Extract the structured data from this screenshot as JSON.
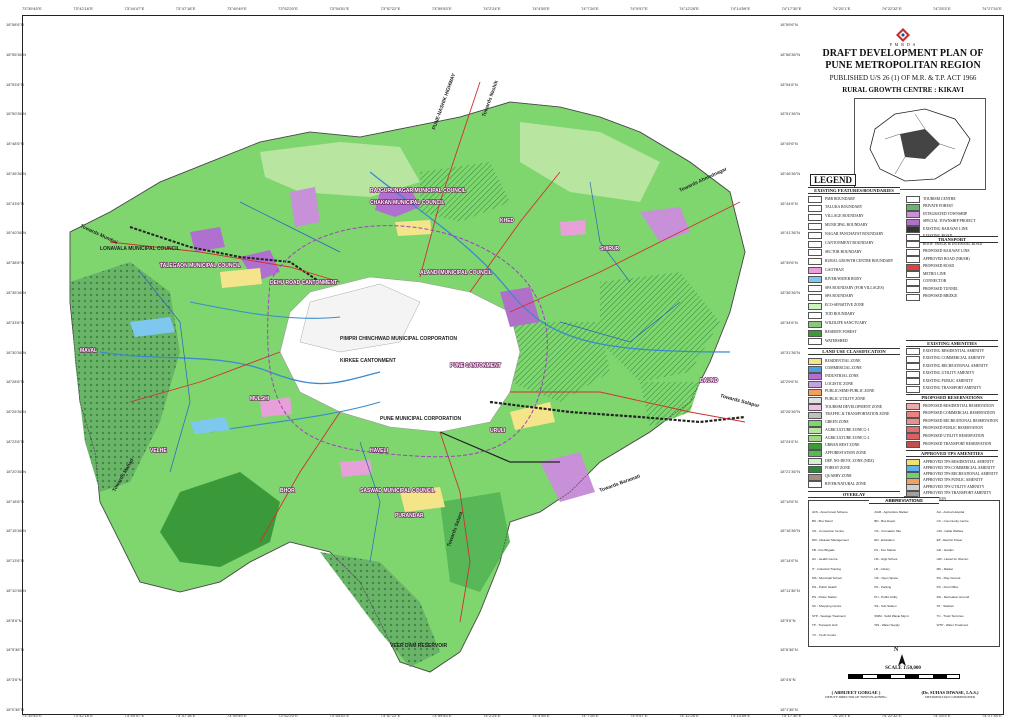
{
  "ticks_top": [
    "73°39'45\"E",
    "73°42'16\"E",
    "73°44'47\"E",
    "73°47'18\"E",
    "73°49'49\"E",
    "73°52'20\"E",
    "73°54'51\"E",
    "73°57'22\"E",
    "73°59'53\"E",
    "74°2'24\"E",
    "74°4'55\"E",
    "74°7'26\"E",
    "74°9'57\"E",
    "74°12'28\"E",
    "74°14'59\"E",
    "74°17'30\"E",
    "74°20'1\"E",
    "74°22'32\"E",
    "74°25'3\"E",
    "74°27'34\"E"
  ],
  "ticks_bottom": [
    "73°39'45\"E",
    "73°42'16\"E",
    "73°44'47\"E",
    "73°47'18\"E",
    "73°49'49\"E",
    "73°52'20\"E",
    "73°54'51\"E",
    "73°57'22\"E",
    "73°59'53\"E",
    "74°2'24\"E",
    "74°4'55\"E",
    "74°7'26\"E",
    "74°9'57\"E",
    "74°12'28\"E",
    "74°14'59\"E",
    "74°17'30\"E",
    "74°20'1\"E",
    "74°22'32\"E",
    "74°25'3\"E",
    "74°27'34\"E"
  ],
  "ticks_left": [
    "18°58'6\"N",
    "18°55'36\"N",
    "18°53'6\"N",
    "18°50'36\"N",
    "18°48'6\"N",
    "18°45'36\"N",
    "18°43'6\"N",
    "18°40'36\"N",
    "18°38'6\"N",
    "18°35'36\"N",
    "18°33'6\"N",
    "18°30'36\"N",
    "18°28'6\"N",
    "18°25'36\"N",
    "18°23'6\"N",
    "18°20'36\"N",
    "18°18'6\"N",
    "18°15'36\"N",
    "18°13'6\"N",
    "18°10'36\"N",
    "18°8'6\"N",
    "18°5'36\"N",
    "18°3'6\"N",
    "18°0'36\"N"
  ],
  "ticks_right": [
    "18°59'6\"N",
    "18°56'36\"N",
    "18°54'6\"N",
    "18°51'36\"N",
    "18°49'6\"N",
    "18°46'36\"N",
    "18°44'6\"N",
    "18°41'36\"N",
    "18°39'6\"N",
    "18°36'36\"N",
    "18°34'6\"N",
    "18°31'36\"N",
    "18°29'6\"N",
    "18°26'36\"N",
    "18°24'6\"N",
    "18°21'36\"N",
    "18°19'6\"N",
    "18°16'36\"N",
    "18°14'6\"N",
    "18°11'36\"N",
    "18°9'6\"N",
    "18°6'36\"N",
    "18°4'6\"N",
    "18°1'36\"N"
  ],
  "header": {
    "brand_small": "P M R D A",
    "title1": "DRAFT DEVELOPMENT PLAN OF",
    "title2": "PUNE METROPOLITAN REGION",
    "published": "PUBLISHED U/S 26 (1) OF M.R. & T.P. ACT 1966",
    "rgc": "RURAL GROWTH CENTRE : KIKAVI",
    "legend": "LEGEND"
  },
  "sections": {
    "existing": "EXISTING FEATURES/BOUNDARIES",
    "transport": "TRANSPORT",
    "landuse": "LAND USE CLASSIFICATION",
    "amenities": "EXISTING AMENITIES",
    "proposed": "PROPOSED RESERVATIONS",
    "approved": "APPROVED TPS AMENITIES",
    "overlay": "OVERLAY",
    "abbr": "ABBREVIATIONS"
  },
  "legend_left": [
    {
      "label": "PMR BOUNDARY",
      "color": "#ffffff"
    },
    {
      "label": "TALUKA BOUNDARY",
      "color": "#ffffff"
    },
    {
      "label": "VILLAGE BOUNDARY",
      "color": "#ffffff"
    },
    {
      "label": "MUNICIPAL BOUNDARY",
      "color": "#ffffff"
    },
    {
      "label": "NAGAR PANCHAYAT BOUNDARY",
      "color": "#ffffff"
    },
    {
      "label": "CANTONMENT BOUNDARY",
      "color": "#ffffff"
    },
    {
      "label": "SECTOR BOUNDARY",
      "color": "#ffffff"
    },
    {
      "label": "RURAL GROWTH CENTRE BOUNDARY",
      "color": "#ffffff"
    },
    {
      "label": "GAOTHAN",
      "color": "#e8a0d8"
    },
    {
      "label": "RIVER/WATER BODY",
      "color": "#7ec8f0"
    },
    {
      "label": "SPA BOUNDARY (FOR VILLAGES)",
      "color": "#ffffff"
    },
    {
      "label": "SPA BOUNDARY",
      "color": "#ffffff"
    },
    {
      "label": "ECO-SENSITIVE ZONE",
      "color": "#d0f0c0"
    },
    {
      "label": "TOD BOUNDARY",
      "color": "#ffffff"
    },
    {
      "label": "WILDLIFE SANCTUARY",
      "color": "#88c878"
    },
    {
      "label": "RESERVE FOREST",
      "color": "#3a9a3a"
    },
    {
      "label": "WATERSHED",
      "color": "#ffffff"
    }
  ],
  "legend_right": [
    {
      "label": "TOURISM CENTRE",
      "color": "#ffffff"
    },
    {
      "label": "PRIVATE FOREST",
      "color": "#6ab46a"
    },
    {
      "label": "INTEGRATED TOWNSHIP",
      "color": "#c890d8"
    },
    {
      "label": "SPECIAL TOWNSHIP PROJECT",
      "color": "#b070c8"
    },
    {
      "label": "EXISTING RAILWAY LINE",
      "color": "#333333"
    },
    {
      "label": "EXISTING ROAD",
      "color": "#ffffff"
    },
    {
      "label": "ROOF TRACK & INTERNAL ROAD",
      "color": "#ffffff"
    },
    {
      "label": "PROPOSED RAILWAY LINE",
      "color": "#ffffff"
    },
    {
      "label": "APPROVED ROAD (NH/SH)",
      "color": "#ffffff"
    },
    {
      "label": "PROPOSED ROAD",
      "color": "#e04040"
    },
    {
      "label": "METRO LINE",
      "color": "#ffffff"
    },
    {
      "label": "CONNECTOR",
      "color": "#ffffff"
    },
    {
      "label": "PROPOSED TUNNEL",
      "color": "#ffffff"
    },
    {
      "label": "PROPOSED BRIDGE",
      "color": "#ffffff"
    }
  ],
  "landuse": [
    {
      "label": "RESIDENTIAL ZONE",
      "color": "#f5e58a"
    },
    {
      "label": "COMMERCIAL ZONE",
      "color": "#4aa0e0"
    },
    {
      "label": "INDUSTRIAL ZONE",
      "color": "#b070d0"
    },
    {
      "label": "LOGISTIC ZONE",
      "color": "#c8a0e0"
    },
    {
      "label": "PUBLIC/SEMI-PUBLIC ZONE",
      "color": "#f0a060"
    },
    {
      "label": "PUBLIC UTILITY ZONE",
      "color": "#e0e0e0"
    },
    {
      "label": "TOURISM DEVELOPMENT ZONE",
      "color": "#f0c0e0"
    },
    {
      "label": "TRAFFIC & TRANSPORTATION ZONE",
      "color": "#c0c0c0"
    },
    {
      "label": "GREEN ZONE",
      "color": "#7fd66f"
    },
    {
      "label": "AGRICULTURE ZONE G-1",
      "color": "#b8e6a0"
    },
    {
      "label": "AGRICULTURE ZONE G-2",
      "color": "#a0d888"
    },
    {
      "label": "URBAN REST ZONE",
      "color": "#3c9c3c"
    },
    {
      "label": "AFFORESTATION ZONE",
      "color": "#58b858"
    },
    {
      "label": "DEF. NO-DEVE. ZONE (NDZ)",
      "color": "#d8eed0"
    },
    {
      "label": "FOREST ZONE",
      "color": "#2a8a3a"
    },
    {
      "label": "QUARRY ZONE",
      "color": "#a09080"
    },
    {
      "label": "RIVER/NATURAL ZONE",
      "color": "#ffffff"
    }
  ],
  "amenities": [
    {
      "label": "EXISTING RESIDENTIAL AMENITY",
      "color": "#ffffff"
    },
    {
      "label": "EXISTING COMMERCIAL AMENITY",
      "color": "#ffffff"
    },
    {
      "label": "EXISTING RECREATIONAL AMENITY",
      "color": "#ffffff"
    },
    {
      "label": "EXISTING UTILITY AMENITY",
      "color": "#ffffff"
    },
    {
      "label": "EXISTING PUBLIC AMENITY",
      "color": "#ffffff"
    },
    {
      "label": "EXISTING TRANSPORT AMENITY",
      "color": "#ffffff"
    }
  ],
  "proposed": [
    {
      "label": "PROPOSED RESIDENTIAL RESERVATION",
      "color": "#f0a8a8"
    },
    {
      "label": "PROPOSED COMMERCIAL RESERVATION",
      "color": "#f08080"
    },
    {
      "label": "PROPOSED RECREATIONAL RESERVATION",
      "color": "#e89090"
    },
    {
      "label": "PROPOSED PUBLIC RESERVATION",
      "color": "#e07070"
    },
    {
      "label": "PROPOSED UTILITY RESERVATION",
      "color": "#d86060"
    },
    {
      "label": "PROPOSED TRANSPORT RESERVATION",
      "color": "#c05050"
    }
  ],
  "approved": [
    {
      "label": "APPROVED TPS RESIDENTIAL AMENITY",
      "color": "#f0e070"
    },
    {
      "label": "APPROVED TPS COMMERCIAL AMENITY",
      "color": "#60b0f0"
    },
    {
      "label": "APPROVED TPS RECREATIONAL AMENITY",
      "color": "#70d070"
    },
    {
      "label": "APPROVED TPS PUBLIC AMENITY",
      "color": "#f0a060"
    },
    {
      "label": "APPROVED TPS UTILITY AMENITY",
      "color": "#d0d0d0"
    },
    {
      "label": "APPROVED TPS TRANSPORT AMENITY",
      "color": "#a0a0a0"
    }
  ],
  "overlay": [
    {
      "label": "HILL STATION",
      "color": "#ffffff"
    }
  ],
  "abbreviations": [
    "AFS - Area Forest Scheme",
    "AGM - Agriculture Market",
    "AH - Animal Hospital",
    "BS - Bus Stand",
    "BD - Bus Depot",
    "CC - Community Centre",
    "CN - Convention Centre",
    "CS - Cremation Site",
    "CW - Cattle Welfare",
    "DM - Disaster Management",
    "ED - Education",
    "EP - Electric Power",
    "FB - Fire Brigade",
    "FS - Fire Station",
    "GD - Garden",
    "HC - Health Centre",
    "HS - High School",
    "HW - Hostel for Women",
    "IT - Industrial Training",
    "LB - Library",
    "MK - Market",
    "MS - Municipal School",
    "OS - Open Space",
    "PG - Play Ground",
    "PH - Public Health",
    "PK - Parking",
    "PO - Post Office",
    "PS - Police Station",
    "PU - Public Utility",
    "RG - Recreation Ground",
    "SC - Shopping Centre",
    "SS - Sub Station",
    "ST - Stadium",
    "STP - Sewage Treatment",
    "SWM - Solid Waste Mgmt",
    "TC - Truck Terminus",
    "TP - Transport Hub",
    "WS - Water Supply",
    "WTP - Water Treatment",
    "YC - Youth Centre"
  ],
  "footer": {
    "north": "N",
    "scale": "SCALE 1:50,000",
    "sig1": "( ABHIJEET GORGAE )",
    "sig1_sub": "DEPUTY DIRECTOR OF TOWN PLANNING",
    "sig2": "(Dr. SUHAS DIWASE, I.A.S.)",
    "sig2_sub": "METROPOLITAN COMMISSIONER"
  },
  "map_labels": [
    {
      "t": "PUNE-NASHIK HIGHWAY",
      "style": "ml-d"
    },
    {
      "t": "CHAKAN MUNICIPAL COUNCIL",
      "style": "ml"
    },
    {
      "t": "RAJGURUNAGAR MUNICIPAL COUNCIL",
      "style": "ml"
    },
    {
      "t": "LONAVALA MUNICIPAL COUNCIL",
      "style": "ml-d"
    },
    {
      "t": "TALEGAON MUNICIPAL COUNCIL",
      "style": "ml"
    },
    {
      "t": "DEHU ROAD CANTONMENT",
      "style": "ml"
    },
    {
      "t": "PIMPRI CHINCHWAD MUNICIPAL CORPORATION",
      "style": "ml-d"
    },
    {
      "t": "KIRKEE CANTONMENT",
      "style": "ml-d"
    },
    {
      "t": "PUNE MUNICIPAL CORPORATION",
      "style": "ml-d"
    },
    {
      "t": "ALANDI MUNICIPAL COUNCIL",
      "style": "ml"
    },
    {
      "t": "PUNE CANTONMENT",
      "style": "ml"
    },
    {
      "t": "SASWAD MUNICIPAL COUNCIL",
      "style": "ml"
    },
    {
      "t": "URULI",
      "style": "ml"
    },
    {
      "t": "SHIRUR",
      "style": "ml"
    },
    {
      "t": "DAUND",
      "style": "ml"
    },
    {
      "t": "MULSHI",
      "style": "ml"
    },
    {
      "t": "BHOR",
      "style": "ml"
    },
    {
      "t": "VELHE",
      "style": "ml"
    },
    {
      "t": "MAVAL",
      "style": "ml"
    },
    {
      "t": "KHED",
      "style": "ml"
    },
    {
      "t": "PURANDAR",
      "style": "ml"
    },
    {
      "t": "HAVELI",
      "style": "ml"
    },
    {
      "t": "VEER DAM RESERVOIR",
      "style": "ml-d"
    },
    {
      "t": "Towards Nashik",
      "style": "ml-d"
    },
    {
      "t": "Towards Ahmednagar",
      "style": "ml-d"
    },
    {
      "t": "Towards Solapur",
      "style": "ml-d"
    },
    {
      "t": "Towards Satara",
      "style": "ml-d"
    },
    {
      "t": "Towards Baramati",
      "style": "ml-d"
    },
    {
      "t": "Towards Mumbai",
      "style": "ml-d"
    },
    {
      "t": "Towards Mahad",
      "style": "ml-d"
    }
  ]
}
